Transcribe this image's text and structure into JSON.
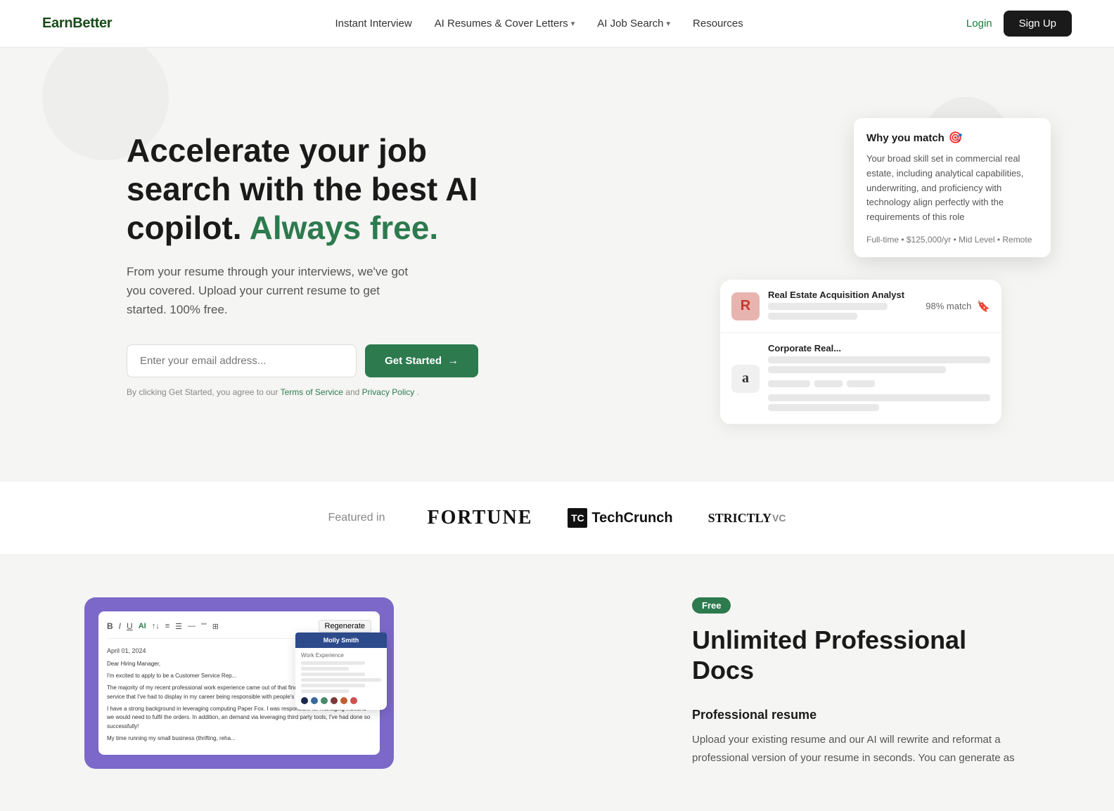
{
  "brand": {
    "logo": "EarnBetter"
  },
  "nav": {
    "links": [
      {
        "label": "Instant Interview",
        "hasDropdown": false
      },
      {
        "label": "AI Resumes & Cover Letters",
        "hasDropdown": true
      },
      {
        "label": "AI Job Search",
        "hasDropdown": true
      },
      {
        "label": "Resources",
        "hasDropdown": false
      }
    ],
    "login": "Login",
    "signup": "Sign Up"
  },
  "hero": {
    "title_plain": "Accelerate your job search with the best AI copilot.",
    "title_accent": "Always free.",
    "subtitle": "From your resume through your interviews, we've got you covered. Upload your current resume to get started. 100% free.",
    "email_placeholder": "Enter your email address...",
    "cta_button": "Get Started",
    "terms_pre": "By clicking Get Started, you agree to our ",
    "terms_link1": "Terms of Service",
    "terms_and": " and ",
    "terms_link2": "Privacy Policy",
    "terms_post": "."
  },
  "job_card": {
    "match_label": "98% match",
    "company1": {
      "letter": "R",
      "title": "Real Estate Acquisition Analyst"
    },
    "company2": {
      "letter": "a",
      "title": "Corporate Real..."
    },
    "popover": {
      "header": "Why you match",
      "body": "Your broad skill set in commercial real estate, including analytical capabilities, underwriting, and proficiency with technology align perfectly with the requirements of this role",
      "meta": "Full-time • $125,000/yr • Mid Level • Remote"
    }
  },
  "featured": {
    "label": "Featured in",
    "logos": [
      {
        "name": "Fortune",
        "display": "FORTUNE"
      },
      {
        "name": "TechCrunch",
        "display": "TechCrunch"
      },
      {
        "name": "StrictlyVC",
        "display": "STRICTLY",
        "suffix": "VC"
      }
    ]
  },
  "lower": {
    "badge": "Free",
    "title": "Unlimited Professional Docs",
    "subtitle": "Professional resume",
    "description": "Upload your existing resume and our AI will rewrite and reformat a professional version of your resume in seconds. You can generate as",
    "resume_name": "Molly Smith",
    "editor": {
      "toolbar_items": [
        "B",
        "I",
        "U",
        "AI",
        "↑↓",
        "≡",
        "☰",
        "—",
        "\"\"",
        "⊞"
      ],
      "regen_btn": "Regenerate",
      "date": "April 01, 2024",
      "salutation": "Dear Hiring Manager,",
      "para1": "I'm excited to apply to be a Customer Service Rep...",
      "para2": "The majority of my recent professional work experience came out of that find into a customer success service that I've had to display in my career being responsible with people's sensitive health data.",
      "para3": "I have a strong background in leveraging computing Paper Fox. I was responsible for managing inbound we would need to fulfil the orders. In addition, an demand via leveraging third party tools, I've had done so successfully!",
      "para4": "My time running my small business (thrifting, reha..."
    }
  }
}
